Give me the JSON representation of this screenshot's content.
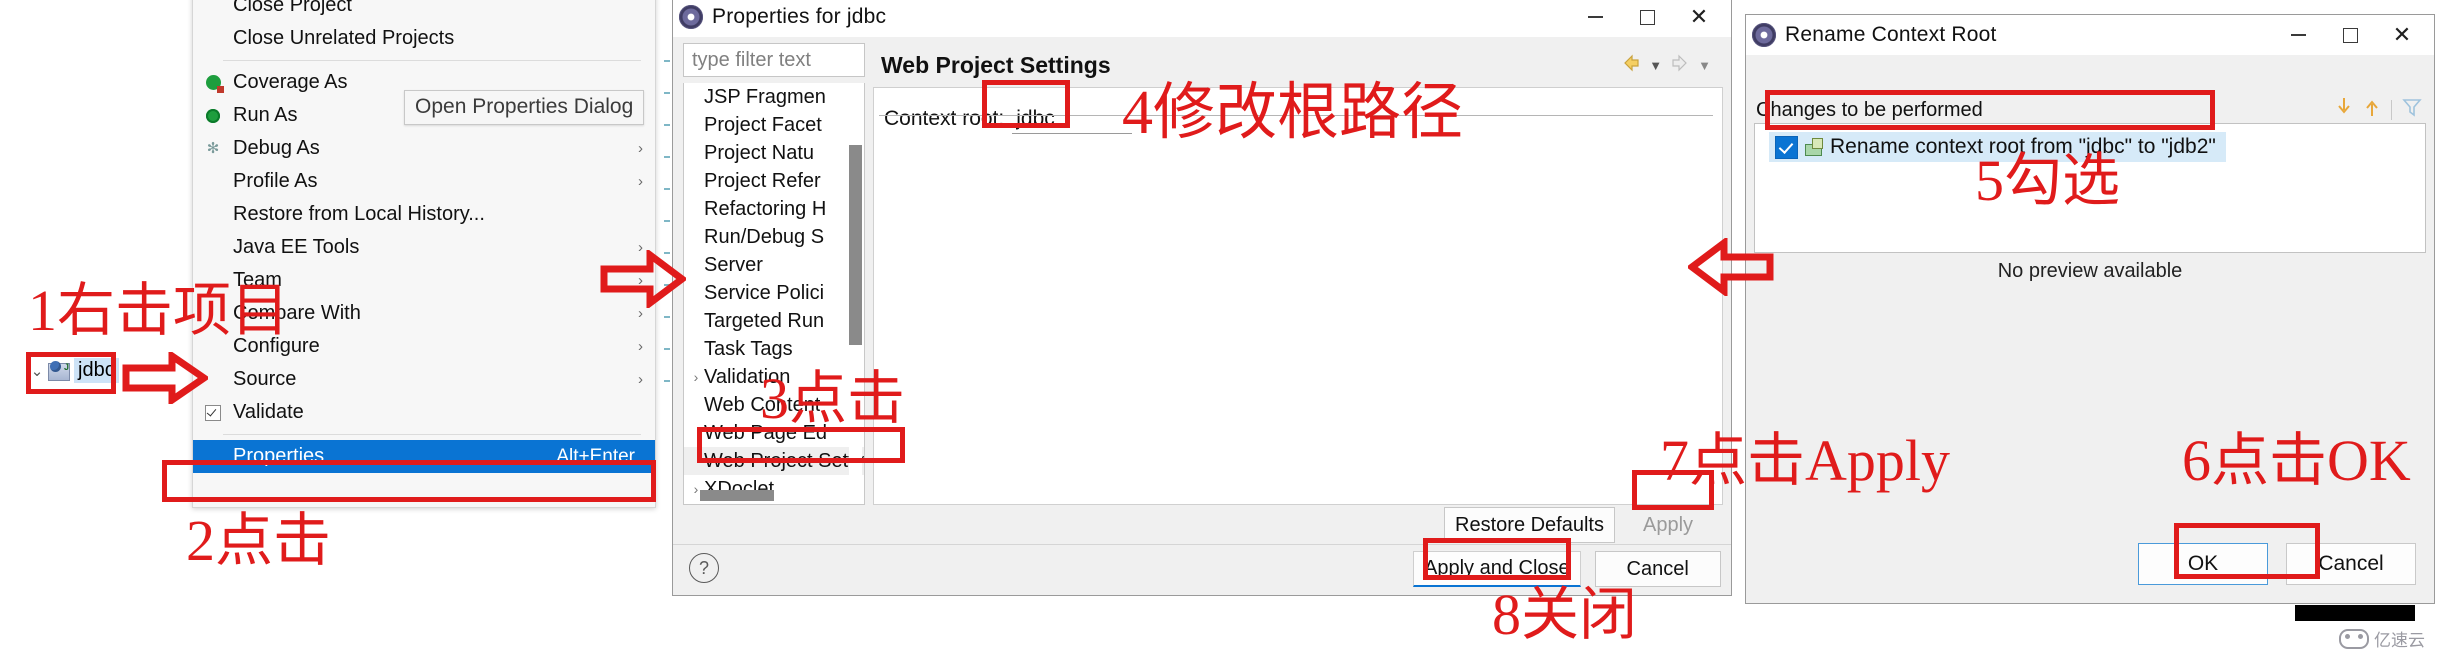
{
  "context_menu": {
    "items": [
      {
        "label": "Close Project",
        "icon": "none",
        "submenu": false,
        "accel": ""
      },
      {
        "label": "Close Unrelated Projects",
        "icon": "none",
        "submenu": false,
        "accel": ""
      },
      {
        "separator": true
      },
      {
        "label": "Coverage As",
        "icon": "coverage-icon",
        "submenu": false,
        "accel": ""
      },
      {
        "label": "Run As",
        "icon": "run-icon",
        "submenu": true,
        "accel": ""
      },
      {
        "label": "Debug As",
        "icon": "debug-icon",
        "submenu": true,
        "accel": ""
      },
      {
        "label": "Profile As",
        "icon": "none",
        "submenu": true,
        "accel": ""
      },
      {
        "label": "Restore from Local History...",
        "icon": "none",
        "submenu": false,
        "accel": ""
      },
      {
        "label": "Java EE Tools",
        "icon": "none",
        "submenu": true,
        "accel": ""
      },
      {
        "label": "Team",
        "icon": "none",
        "submenu": true,
        "accel": ""
      },
      {
        "label": "Compare With",
        "icon": "none",
        "submenu": true,
        "accel": ""
      },
      {
        "label": "Configure",
        "icon": "none",
        "submenu": true,
        "accel": ""
      },
      {
        "label": "Source",
        "icon": "none",
        "submenu": true,
        "accel": ""
      },
      {
        "label": "Validate",
        "icon": "checkbox-icon",
        "submenu": false,
        "accel": ""
      },
      {
        "separator": true
      },
      {
        "label": "Properties",
        "icon": "none",
        "submenu": false,
        "accel": "Alt+Enter",
        "selected": true
      }
    ],
    "tooltip": "Open Properties Dialog"
  },
  "project_tree": {
    "twisty": "⌄",
    "project_name": "jdbc"
  },
  "properties_dialog": {
    "title": "Properties for jdbc",
    "window_buttons": {
      "minimize": "minimize-icon",
      "maximize": "maximize-icon",
      "close": "close-icon"
    },
    "filter_placeholder": "type filter text",
    "tree_items": [
      {
        "label": "JSP Fragmen",
        "expandable": false
      },
      {
        "label": "Project Facet",
        "expandable": false
      },
      {
        "label": "Project Natu",
        "expandable": false
      },
      {
        "label": "Project Refer",
        "expandable": false
      },
      {
        "label": "Refactoring H",
        "expandable": false
      },
      {
        "label": "Run/Debug S",
        "expandable": false
      },
      {
        "label": "Server",
        "expandable": false
      },
      {
        "label": "Service Polici",
        "expandable": false
      },
      {
        "label": "Targeted Run",
        "expandable": false
      },
      {
        "label": "Task Tags",
        "expandable": false
      },
      {
        "label": "Validation",
        "expandable": true
      },
      {
        "label": "Web Content",
        "expandable": false
      },
      {
        "label": "Web Page Ed",
        "expandable": false
      },
      {
        "label": "Web Project Settings",
        "expandable": false,
        "selected": true
      },
      {
        "label": "XDoclet",
        "expandable": true
      }
    ],
    "page_title": "Web Project Settings",
    "context_root_label": "Context root:",
    "context_root_value": "jdbc",
    "buttons": {
      "restore_defaults": "Restore Defaults",
      "apply": "Apply",
      "apply_and_close": "Apply and Close",
      "cancel": "Cancel",
      "help": "?"
    }
  },
  "rename_dialog": {
    "title": "Rename Context Root",
    "window_buttons": {
      "minimize": "minimize-icon",
      "maximize": "maximize-icon",
      "close": "close-icon"
    },
    "section_label": "Changes to be performed",
    "change_item": "Rename context root from \"jdbc\" to \"jdb2\"",
    "change_item_checked": true,
    "preview_text": "No preview available",
    "buttons": {
      "ok": "OK",
      "cancel": "Cancel"
    }
  },
  "annotations": [
    {
      "id": "a1",
      "text": "1右击项目"
    },
    {
      "id": "a2",
      "text": "2点击"
    },
    {
      "id": "a3",
      "text": "3点击"
    },
    {
      "id": "a4",
      "text": "4修改根路径"
    },
    {
      "id": "a5",
      "text": "5勾选"
    },
    {
      "id": "a6",
      "text": "6点击OK"
    },
    {
      "id": "a7",
      "text": "7点击Apply"
    },
    {
      "id": "a8",
      "text": "8关闭"
    }
  ],
  "watermark": {
    "text": "亿速云"
  },
  "colors": {
    "annotation_red": "#e01b1b",
    "selection_blue": "#0a74d3",
    "list_highlight": "#d6eaf8",
    "tree_highlight": "#cde3f7"
  }
}
